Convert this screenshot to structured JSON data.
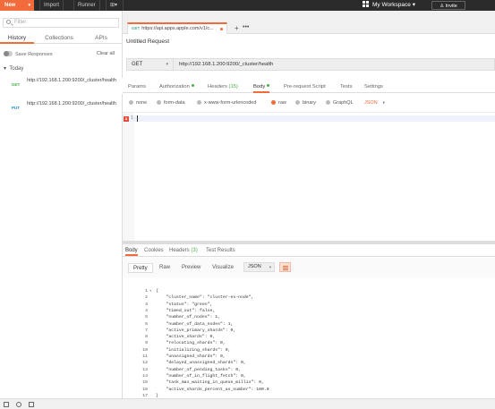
{
  "topbar": {
    "new_label": "New",
    "import_label": "Import",
    "runner_label": "Runner",
    "workspace_label": "My Workspace",
    "invite_label": "Invite"
  },
  "sidebar": {
    "filter_placeholder": "Filter",
    "tabs": [
      "History",
      "Collections",
      "APIs"
    ],
    "save_responses_label": "Save Responses",
    "clear_all_label": "Clear all",
    "group_label": "Today",
    "history": [
      {
        "method": "GET",
        "url": "http://192.168.1.200:9200/_cluster/health",
        "method_color": "#47b04b"
      },
      {
        "method": "PUT",
        "url": "http://192.168.1.200:9200/_cluster/health",
        "method_color": "#1e8ed6"
      }
    ]
  },
  "request_tab": {
    "method": "GET",
    "label": "https://api.apps.apple.com/v1/c..."
  },
  "request": {
    "title": "Untitled Request",
    "method": "GET",
    "url": "http://192.168.1.200:9200/_cluster/health"
  },
  "req_tabs": {
    "params": "Params",
    "authorization": "Authorization",
    "headers": "Headers",
    "headers_count": "(15)",
    "body": "Body",
    "prerequest": "Pre-request Script",
    "tests": "Tests",
    "settings": "Settings"
  },
  "body_types": [
    "none",
    "form-data",
    "x-www-form-urlencoded",
    "raw",
    "binary",
    "GraphQL"
  ],
  "body_format": "JSON",
  "editor": {
    "line1": "1",
    "error_mark": "x"
  },
  "response_tabs": {
    "body": "Body",
    "cookies": "Cookies",
    "headers": "Headers",
    "headers_count": "(3)",
    "test_results": "Test Results"
  },
  "response_view": {
    "pretty": "Pretty",
    "raw": "Raw",
    "preview": "Preview",
    "visualize": "Visualize",
    "format": "JSON"
  },
  "response_lines": [
    "{",
    "    \"cluster_name\": \"cluster-es-node\",",
    "    \"status\": \"green\",",
    "    \"timed_out\": false,",
    "    \"number_of_nodes\": 1,",
    "    \"number_of_data_nodes\": 1,",
    "    \"active_primary_shards\": 0,",
    "    \"active_shards\": 0,",
    "    \"relocating_shards\": 0,",
    "    \"initializing_shards\": 0,",
    "    \"unassigned_shards\": 0,",
    "    \"delayed_unassigned_shards\": 0,",
    "    \"number_of_pending_tasks\": 0,",
    "    \"number_of_in_flight_fetch\": 0,",
    "    \"task_max_waiting_in_queue_millis\": 0,",
    "    \"active_shards_percent_as_number\": 100.0",
    "}"
  ],
  "colors": {
    "accent": "#f26b3a",
    "success": "#47b04b"
  }
}
